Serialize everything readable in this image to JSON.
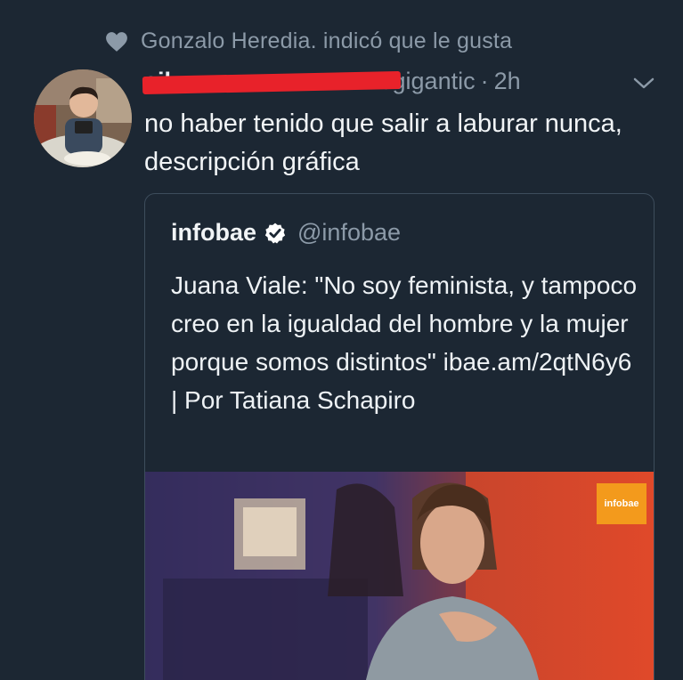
{
  "activity": {
    "text": "Gonzalo Heredia. indicó que le gusta",
    "icon": "heart-icon"
  },
  "tweet": {
    "author_name": "sil",
    "handle": "sgigantic",
    "separator": "·",
    "time": "2h",
    "text": "no haber tenido que salir a laburar nunca, descripción gráfica",
    "menu_icon": "chevron-down-icon"
  },
  "quoted": {
    "name": "infobae",
    "handle": "@infobae",
    "verified_icon": "verified-badge-icon",
    "text": "Juana Viale: \"No soy feminista, y tampoco creo en la igualdad del hombre y la mujer porque somos distintos\" ibae.am/2qtN6y6 | Por Tatiana Schapiro",
    "image_badge": "infobae"
  },
  "colors": {
    "background": "#1c2733",
    "muted": "#8c9aa8",
    "text": "#e8edf1",
    "redaction": "#e8222a",
    "badge": "#f39a1c"
  }
}
